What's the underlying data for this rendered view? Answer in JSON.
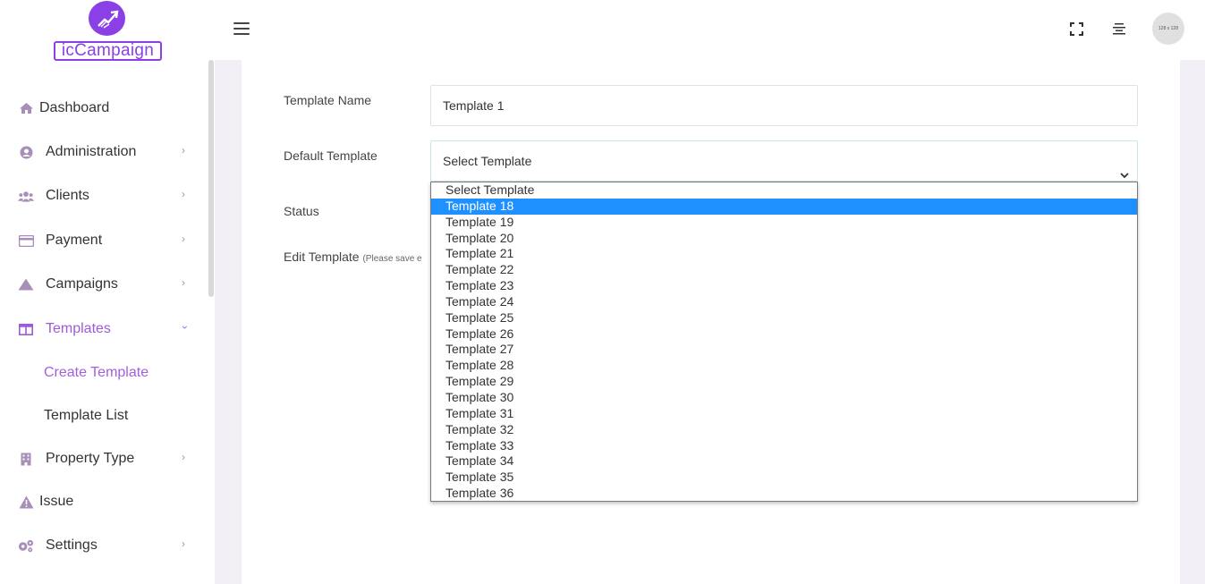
{
  "brand": {
    "logo_text": "icCampaign"
  },
  "sidebar": {
    "items": [
      {
        "label": "Dashboard",
        "icon": "home-icon"
      },
      {
        "label": "Administration",
        "icon": "user-circle-icon"
      },
      {
        "label": "Clients",
        "icon": "users-icon"
      },
      {
        "label": "Payment",
        "icon": "credit-card-icon"
      },
      {
        "label": "Campaigns",
        "icon": "mountain-icon"
      },
      {
        "label": "Templates",
        "icon": "columns-icon"
      },
      {
        "label": "Property Type",
        "icon": "building-icon"
      },
      {
        "label": "Issue",
        "icon": "warning-icon"
      },
      {
        "label": "Settings",
        "icon": "cogs-icon"
      }
    ],
    "sub_items": [
      {
        "label": "Create Template"
      },
      {
        "label": "Template List"
      }
    ]
  },
  "topbar": {
    "avatar_text": "128 x 128"
  },
  "form": {
    "template_name_label": "Template Name",
    "template_name_value": "Template 1",
    "default_template_label": "Default Template",
    "default_template_value": "Select Template",
    "status_label": "Status",
    "edit_template_label": "Edit Template",
    "edit_template_note": "(Please save e"
  },
  "dropdown": {
    "options": [
      "Select Template",
      "Template 18",
      "Template 19",
      "Template 20",
      "Template 21",
      "Template 22",
      "Template 23",
      "Template 24",
      "Template 25",
      "Template 26",
      "Template 27",
      "Template 28",
      "Template 29",
      "Template 30",
      "Template 31",
      "Template 32",
      "Template 33",
      "Template 34",
      "Template 35",
      "Template 36"
    ],
    "highlighted": "Template 18"
  },
  "colors": {
    "accent": "#8b3fe6",
    "highlight": "#1e90ff"
  }
}
